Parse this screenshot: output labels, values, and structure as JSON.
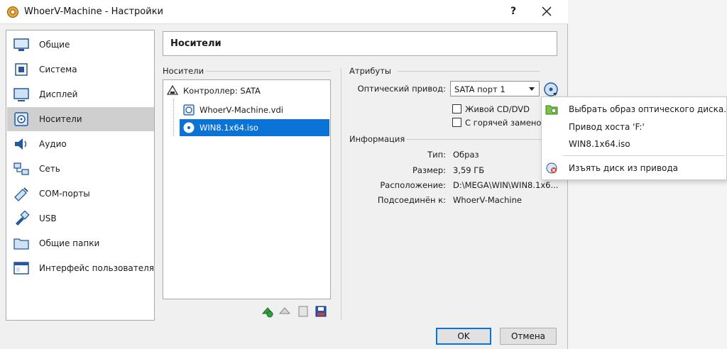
{
  "window": {
    "title": "WhoerV-Machine - Настройки",
    "help": "?"
  },
  "sidebar": {
    "items": [
      {
        "label": "Общие",
        "icon": "general-icon"
      },
      {
        "label": "Система",
        "icon": "system-icon"
      },
      {
        "label": "Дисплей",
        "icon": "display-icon"
      },
      {
        "label": "Носители",
        "icon": "storage-icon",
        "selected": true
      },
      {
        "label": "Аудио",
        "icon": "audio-icon"
      },
      {
        "label": "Сеть",
        "icon": "network-icon"
      },
      {
        "label": "COM-порты",
        "icon": "com-port-icon"
      },
      {
        "label": "USB",
        "icon": "usb-icon"
      },
      {
        "label": "Общие папки",
        "icon": "shared-folder-icon"
      },
      {
        "label": "Интерфейс пользователя",
        "icon": "user-interface-icon"
      }
    ]
  },
  "page": {
    "title": "Носители"
  },
  "storage": {
    "group_label": "Носители",
    "controller": "Контроллер: SATA",
    "devices": [
      {
        "label": "WhoerV-Machine.vdi",
        "icon": "hard-disk-icon"
      },
      {
        "label": "WIN8.1x64.iso",
        "icon": "optical-disc-icon",
        "selected": true
      }
    ]
  },
  "attributes": {
    "group_label": "Атрибуты",
    "optical_drive_label": "Оптический привод:",
    "optical_drive_value": "SATA порт 1",
    "live_cd_label": "Живой CD/DVD",
    "hot_plug_label": "С горячей заменой"
  },
  "info": {
    "group_label": "Информация",
    "type_label": "Тип:",
    "type_value": "Образ",
    "size_label": "Размер:",
    "size_value": "3,59 ГБ",
    "location_label": "Расположение:",
    "location_value": "D:\\MEGA\\WIN\\WIN8.1x6...",
    "attached_label": "Подсоединён к:",
    "attached_value": "WhoerV-Machine"
  },
  "popup_menu": {
    "choose_image": "Выбрать образ оптического диска...",
    "host_drive": "Привод хоста 'F:'",
    "recent_image": "WIN8.1x64.iso",
    "remove_disk": "Изъять диск из привода"
  },
  "buttons": {
    "ok": "OK",
    "cancel": "Отмена"
  },
  "colors": {
    "selection": "#0b72d6",
    "sidebar_selected": "#cfcfcf"
  }
}
